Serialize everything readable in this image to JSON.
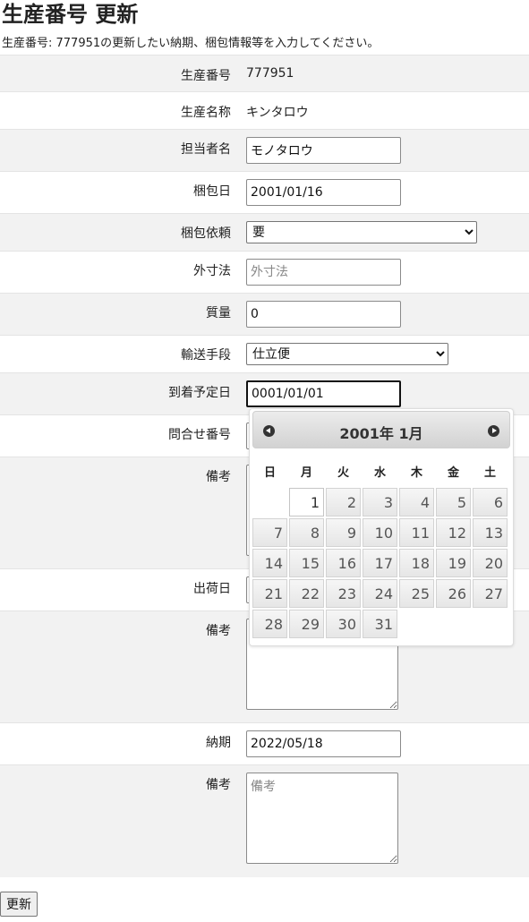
{
  "page": {
    "title": "生産番号 更新",
    "subtitle": "生産番号: 777951の更新したい納期、梱包情報等を入力してください。"
  },
  "form": {
    "production_no": {
      "label": "生産番号",
      "value": "777951"
    },
    "production_name": {
      "label": "生産名称",
      "value": "キンタロウ"
    },
    "person": {
      "label": "担当者名",
      "value": "モノタロウ"
    },
    "packing_date": {
      "label": "梱包日",
      "value": "2001/01/16"
    },
    "packing_request": {
      "label": "梱包依頼",
      "selected": "要"
    },
    "outer_size": {
      "label": "外寸法",
      "placeholder": "外寸法"
    },
    "weight": {
      "label": "質量",
      "value": "0"
    },
    "transport": {
      "label": "輸送手段",
      "selected": "仕立便"
    },
    "arrival_date": {
      "label": "到着予定日",
      "value": "0001/01/01"
    },
    "inquiry_no": {
      "label": "問合せ番号"
    },
    "remarks1": {
      "label": "備考"
    },
    "ship_date": {
      "label": "出荷日"
    },
    "remarks2": {
      "label": "備考"
    },
    "delivery": {
      "label": "納期",
      "value": "2022/05/18"
    },
    "remarks3": {
      "label": "備考",
      "placeholder": "備考"
    }
  },
  "submit_label": "更新",
  "datepicker": {
    "title": "2001年 1月",
    "prev_icon": "prev-month-icon",
    "next_icon": "next-month-icon",
    "weekdays": [
      "日",
      "月",
      "火",
      "水",
      "木",
      "金",
      "土"
    ],
    "first_weekday_index": 1,
    "days_in_month": 31,
    "selected_day": "1"
  },
  "colors": {
    "row_alt": "#f2f2f2",
    "row_border": "#e4e4e4"
  }
}
